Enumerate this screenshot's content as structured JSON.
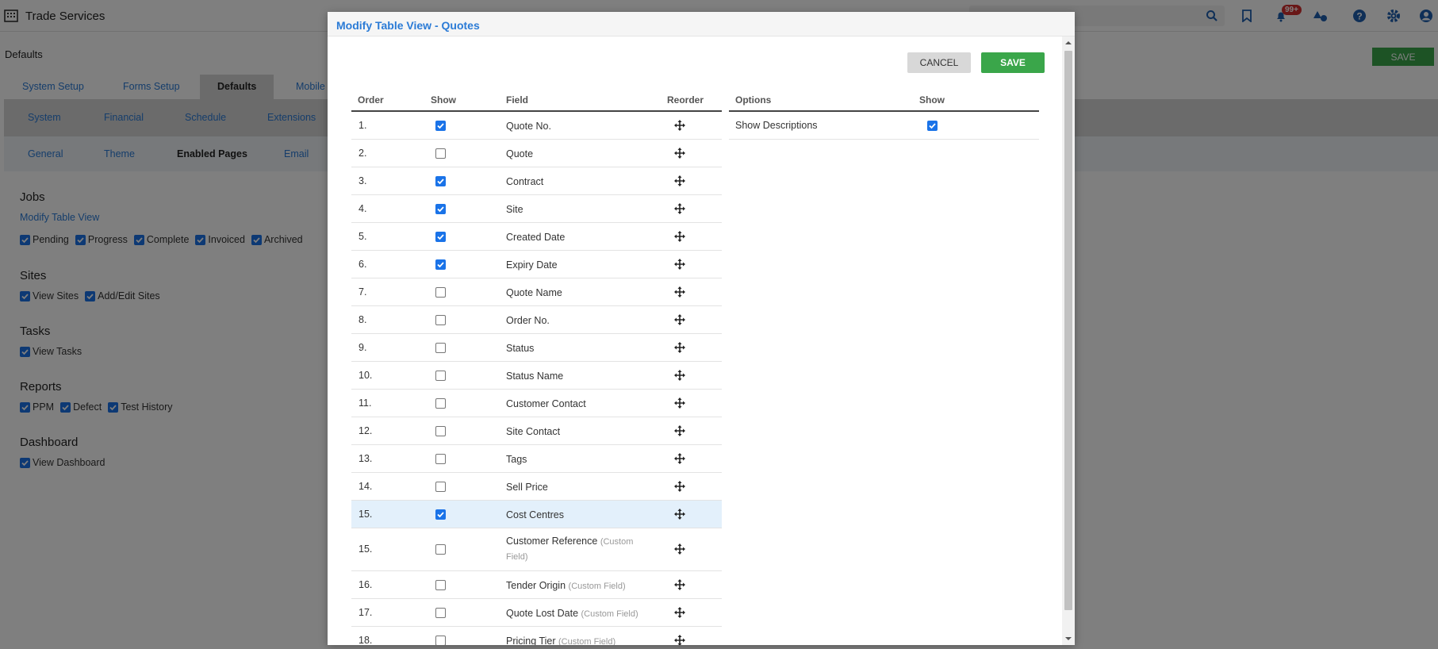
{
  "app": {
    "title": "Trade Services",
    "notification_count": "99+",
    "page_heading": "Defaults",
    "save_label": "SAVE",
    "tabs_primary": [
      "System Setup",
      "Forms Setup",
      "Defaults",
      "Mobile"
    ],
    "tabs_secondary": [
      "System",
      "Financial",
      "Schedule",
      "Extensions"
    ],
    "tabs_tertiary": [
      "General",
      "Theme",
      "Enabled Pages",
      "Email"
    ],
    "sections": {
      "jobs": {
        "title": "Jobs",
        "link": "Modify Table View",
        "options": [
          "Pending",
          "Progress",
          "Complete",
          "Invoiced",
          "Archived"
        ]
      },
      "sites": {
        "title": "Sites",
        "options": [
          "View Sites",
          "Add/Edit Sites"
        ]
      },
      "tasks": {
        "title": "Tasks",
        "options": [
          "View Tasks"
        ]
      },
      "reports": {
        "title": "Reports",
        "options": [
          "PPM",
          "Defect",
          "Test History"
        ]
      },
      "dashboard": {
        "title": "Dashboard",
        "options": [
          "View Dashboard"
        ]
      }
    }
  },
  "modal": {
    "title": "Modify Table View - Quotes",
    "cancel_label": "CANCEL",
    "save_label": "SAVE",
    "columns": {
      "order": "Order",
      "show": "Show",
      "field": "Field",
      "reorder": "Reorder"
    },
    "options_columns": {
      "options": "Options",
      "show": "Show"
    },
    "options": [
      {
        "label": "Show Descriptions",
        "checked": true
      }
    ],
    "rows": [
      {
        "order": "1.",
        "checked": true,
        "field": "Quote No.",
        "sub": ""
      },
      {
        "order": "2.",
        "checked": false,
        "field": "Quote",
        "sub": ""
      },
      {
        "order": "3.",
        "checked": true,
        "field": "Contract",
        "sub": ""
      },
      {
        "order": "4.",
        "checked": true,
        "field": "Site",
        "sub": ""
      },
      {
        "order": "5.",
        "checked": true,
        "field": "Created Date",
        "sub": ""
      },
      {
        "order": "6.",
        "checked": true,
        "field": "Expiry Date",
        "sub": ""
      },
      {
        "order": "7.",
        "checked": false,
        "field": "Quote Name",
        "sub": ""
      },
      {
        "order": "8.",
        "checked": false,
        "field": "Order No.",
        "sub": ""
      },
      {
        "order": "9.",
        "checked": false,
        "field": "Status",
        "sub": ""
      },
      {
        "order": "10.",
        "checked": false,
        "field": "Status Name",
        "sub": ""
      },
      {
        "order": "11.",
        "checked": false,
        "field": "Customer Contact",
        "sub": ""
      },
      {
        "order": "12.",
        "checked": false,
        "field": "Site Contact",
        "sub": ""
      },
      {
        "order": "13.",
        "checked": false,
        "field": "Tags",
        "sub": ""
      },
      {
        "order": "14.",
        "checked": false,
        "field": "Sell Price",
        "sub": ""
      },
      {
        "order": "15.",
        "checked": true,
        "field": "Cost Centres",
        "sub": "",
        "highlight": true
      },
      {
        "order": "15.",
        "checked": false,
        "field": "Customer Reference",
        "sub": "(Custom Field)",
        "tall": true
      },
      {
        "order": "16.",
        "checked": false,
        "field": "Tender Origin",
        "sub": "(Custom Field)"
      },
      {
        "order": "17.",
        "checked": false,
        "field": "Quote Lost Date",
        "sub": "(Custom Field)"
      },
      {
        "order": "18.",
        "checked": false,
        "field": "Pricing Tier",
        "sub": "(Custom Field)"
      }
    ]
  }
}
